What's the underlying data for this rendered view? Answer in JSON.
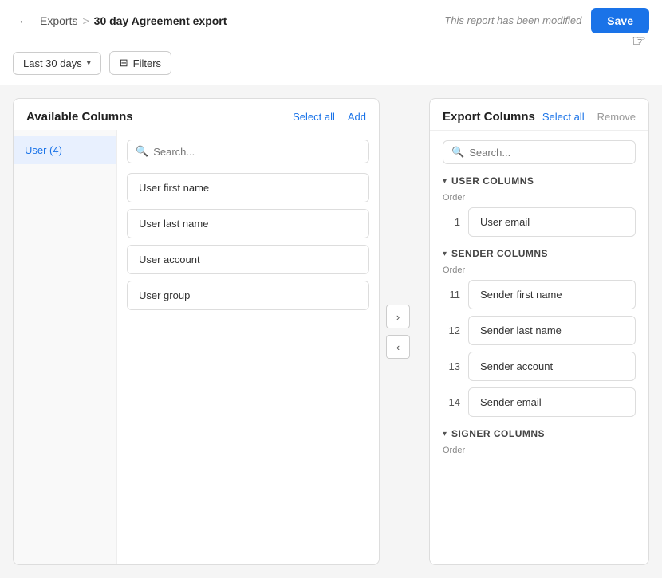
{
  "header": {
    "back_label": "←",
    "breadcrumb_parent": "Exports",
    "breadcrumb_separator": ">",
    "breadcrumb_current": "30 day Agreement export",
    "modified_text": "This report has been modified",
    "save_label": "Save"
  },
  "filters": {
    "date_range": "Last 30 days",
    "filters_label": "Filters"
  },
  "left_panel": {
    "title": "Available Columns",
    "select_all_label": "Select all",
    "add_label": "Add",
    "category_items": [
      {
        "label": "User (4)",
        "active": true
      }
    ],
    "search_placeholder": "Search...",
    "columns": [
      {
        "label": "User first name"
      },
      {
        "label": "User last name"
      },
      {
        "label": "User account"
      },
      {
        "label": "User group"
      }
    ]
  },
  "right_panel": {
    "title": "Export Columns",
    "select_all_label": "Select all",
    "remove_label": "Remove",
    "search_placeholder": "Search...",
    "sections": [
      {
        "id": "user-columns",
        "title": "USER COLUMNS",
        "order_label": "Order",
        "items": [
          {
            "order": "1",
            "label": "User email"
          }
        ]
      },
      {
        "id": "sender-columns",
        "title": "SENDER COLUMNS",
        "order_label": "Order",
        "items": [
          {
            "order": "11",
            "label": "Sender first name"
          },
          {
            "order": "12",
            "label": "Sender last name"
          },
          {
            "order": "13",
            "label": "Sender account"
          },
          {
            "order": "14",
            "label": "Sender email"
          }
        ]
      },
      {
        "id": "signer-columns",
        "title": "SIGNER COLUMNS",
        "order_label": "Order",
        "items": []
      }
    ]
  },
  "arrows": {
    "right_label": "›",
    "left_label": "‹"
  }
}
